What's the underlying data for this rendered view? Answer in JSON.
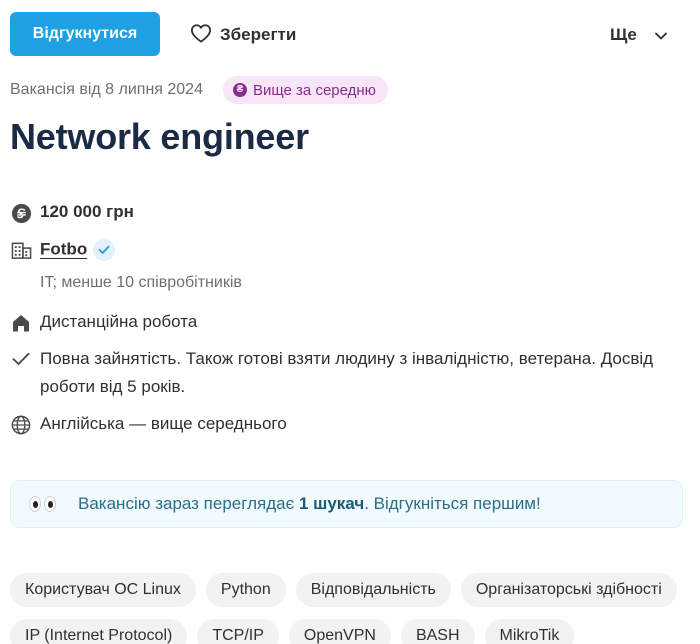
{
  "toolbar": {
    "apply_label": "Відгукнутися",
    "save_label": "Зберегти",
    "more_label": "Ще"
  },
  "vacancy": {
    "date_text": "Вакансія від 8 липня 2024",
    "badge_text": "Вище за середню",
    "title": "Network engineer",
    "salary": "120 000 грн",
    "company": "Fotbo",
    "company_info": "IT; менше 10 співробітників",
    "work_mode": "Дистанційна робота",
    "employment": "Повна зайнятість. Також готові взяти людину з інвалідністю, ветерана. Досвід роботи від 5 років.",
    "language": "Англійська — вище середнього"
  },
  "notice": {
    "prefix": "Вакансію зараз переглядає ",
    "highlight": "1 шукач",
    "suffix": ". Відгукніться першим!"
  },
  "tags": [
    "Користувач ОС Linux",
    "Python",
    "Відповідальність",
    "Організаторські здібності",
    "IP (Internet Protocol)",
    "TCP/IP",
    "OpenVPN",
    "BASH",
    "MikroTik"
  ],
  "colors": {
    "accent": "#1ea0e4",
    "title": "#1c2b45",
    "badge_bg": "#f6e6f8",
    "badge_fg": "#8a2b8f",
    "notice_bg": "#f1fafe"
  },
  "icons": [
    "heart-icon",
    "chevron-down-icon",
    "money-icon",
    "building-icon",
    "verified-check-icon",
    "home-icon",
    "check-icon",
    "globe-icon",
    "eyes-icon"
  ]
}
